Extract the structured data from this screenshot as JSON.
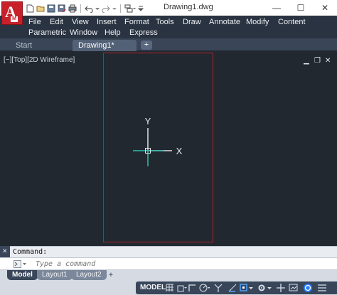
{
  "titlebar": {
    "app_letter": "A",
    "app_badge": "M",
    "title": "Drawing1.dwg",
    "minimize": "—",
    "maximize": "☐",
    "close": "✕"
  },
  "quick_access": [
    "new-icon",
    "open-icon",
    "save-icon",
    "saveas-icon",
    "print-icon",
    "undo-icon",
    "redo-icon",
    "workspace-icon",
    "customize-icon"
  ],
  "menu": {
    "row1": [
      "File",
      "Edit",
      "View",
      "Insert",
      "Format",
      "Tools",
      "Draw",
      "Annotate",
      "Modify",
      "Content"
    ],
    "row2": [
      "Parametric",
      "Window",
      "Help",
      "Express"
    ]
  },
  "file_tabs": [
    {
      "label": "Start"
    },
    {
      "label": "Drawing1*",
      "close": "×"
    }
  ],
  "file_tab_add": "+",
  "viewport": {
    "label": "[−][Top][2D Wireframe]",
    "min": "▁",
    "restore": "❐",
    "close": "✕",
    "ucs_y": "Y",
    "ucs_x": "X",
    "colors": {
      "background": "#212830",
      "page_border": "#b3242c",
      "ucs_axis": "#e0e0e0",
      "cursor_cyan": "#2fbfae"
    }
  },
  "command": {
    "history_label": "Command:",
    "placeholder": "Type a command",
    "close": "✕",
    "settings": "⚙"
  },
  "layout_tabs": [
    "Model",
    "Layout1",
    "Layout2"
  ],
  "layout_tab_add": "+",
  "status": {
    "model_label": "MODEL",
    "icons": [
      "grid-icon",
      "snap-icon",
      "ortho-icon",
      "polar-icon",
      "isodraft-icon",
      "osnap-track-icon",
      "osnap-icon",
      "annotation-scale-icon",
      "workspace-gear-icon",
      "plus-icon",
      "hardware-accel-icon",
      "isolate-icon",
      "clean-screen-icon"
    ]
  }
}
